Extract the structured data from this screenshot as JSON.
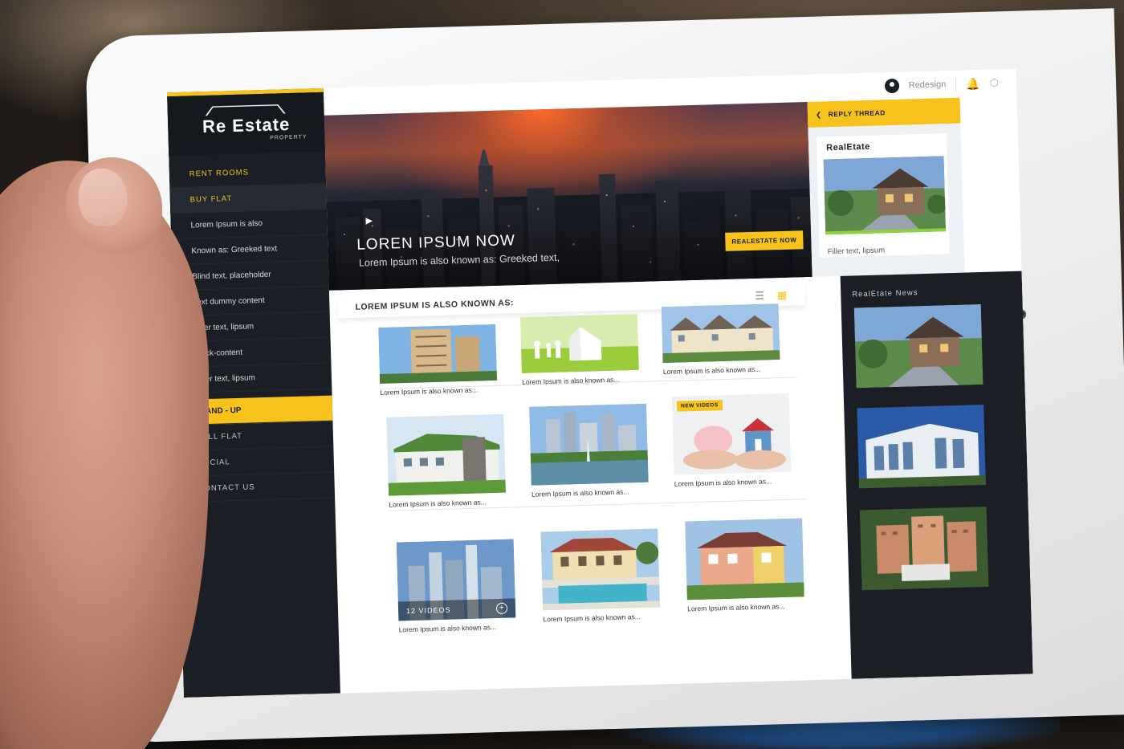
{
  "brand": {
    "name": "Re Estate",
    "tagline": "PROPERTY"
  },
  "topbar": {
    "user_name": "Redesign",
    "bell_icon": "bell-icon",
    "cube_icon": "cube-icon"
  },
  "sidebar": {
    "categories": [
      "RENT ROOMS",
      "BUY FLAT"
    ],
    "items": [
      "Lorem Ipsum is also",
      "Known as: Greeked text",
      "Blind text, placeholder",
      "Text dummy content",
      "Filler text, lipsum",
      "Mock-content",
      "Filler text, lipsum"
    ],
    "sections": [
      "STAND - UP",
      "SELL FLAT",
      "SOCIAL",
      "CONTACT US"
    ],
    "active_section": "STAND - UP"
  },
  "hero": {
    "title": "LOREN IPSUM NOW",
    "subtitle": "Lorem Ipsum is also known as: Greeked text,",
    "button_label": "REALESTATE NOW"
  },
  "content": {
    "heading": "LOREM IPSUM IS ALSO KNOWN AS:",
    "cards": [
      {
        "caption": "Lorem Ipsum is also known as...",
        "image": "apartment-tower"
      },
      {
        "caption": "Lorem Ipsum is also known as...",
        "image": "family-house"
      },
      {
        "caption": "Lorem Ipsum is also known as...",
        "image": "townhouses"
      },
      {
        "caption": "Lorem Ipsum is also known as...",
        "image": "green-roof-building"
      },
      {
        "caption": "Lorem Ipsum is also known as...",
        "image": "city-fountain"
      },
      {
        "caption": "Lorem Ipsum is also known as...",
        "image": "house-savings",
        "badge": "NEW VIDEOS"
      },
      {
        "caption": "Lorem Ipsum is also known as...",
        "image": "skyscrapers",
        "overlay": "12 VIDEOS"
      },
      {
        "caption": "Lorem Ipsum is also known as...",
        "image": "villa-pool"
      },
      {
        "caption": "Lorem Ipsum is also known as...",
        "image": "two-storey-house"
      }
    ]
  },
  "right_panel": {
    "header": "REPLY THREAD",
    "card_title": "RealEtate",
    "card_caption": "Filler text, lipsum",
    "news_title": "RealEtate News"
  },
  "colors": {
    "accent": "#f7c21b",
    "sidebar": "#1b1f25",
    "text": "#333333"
  }
}
